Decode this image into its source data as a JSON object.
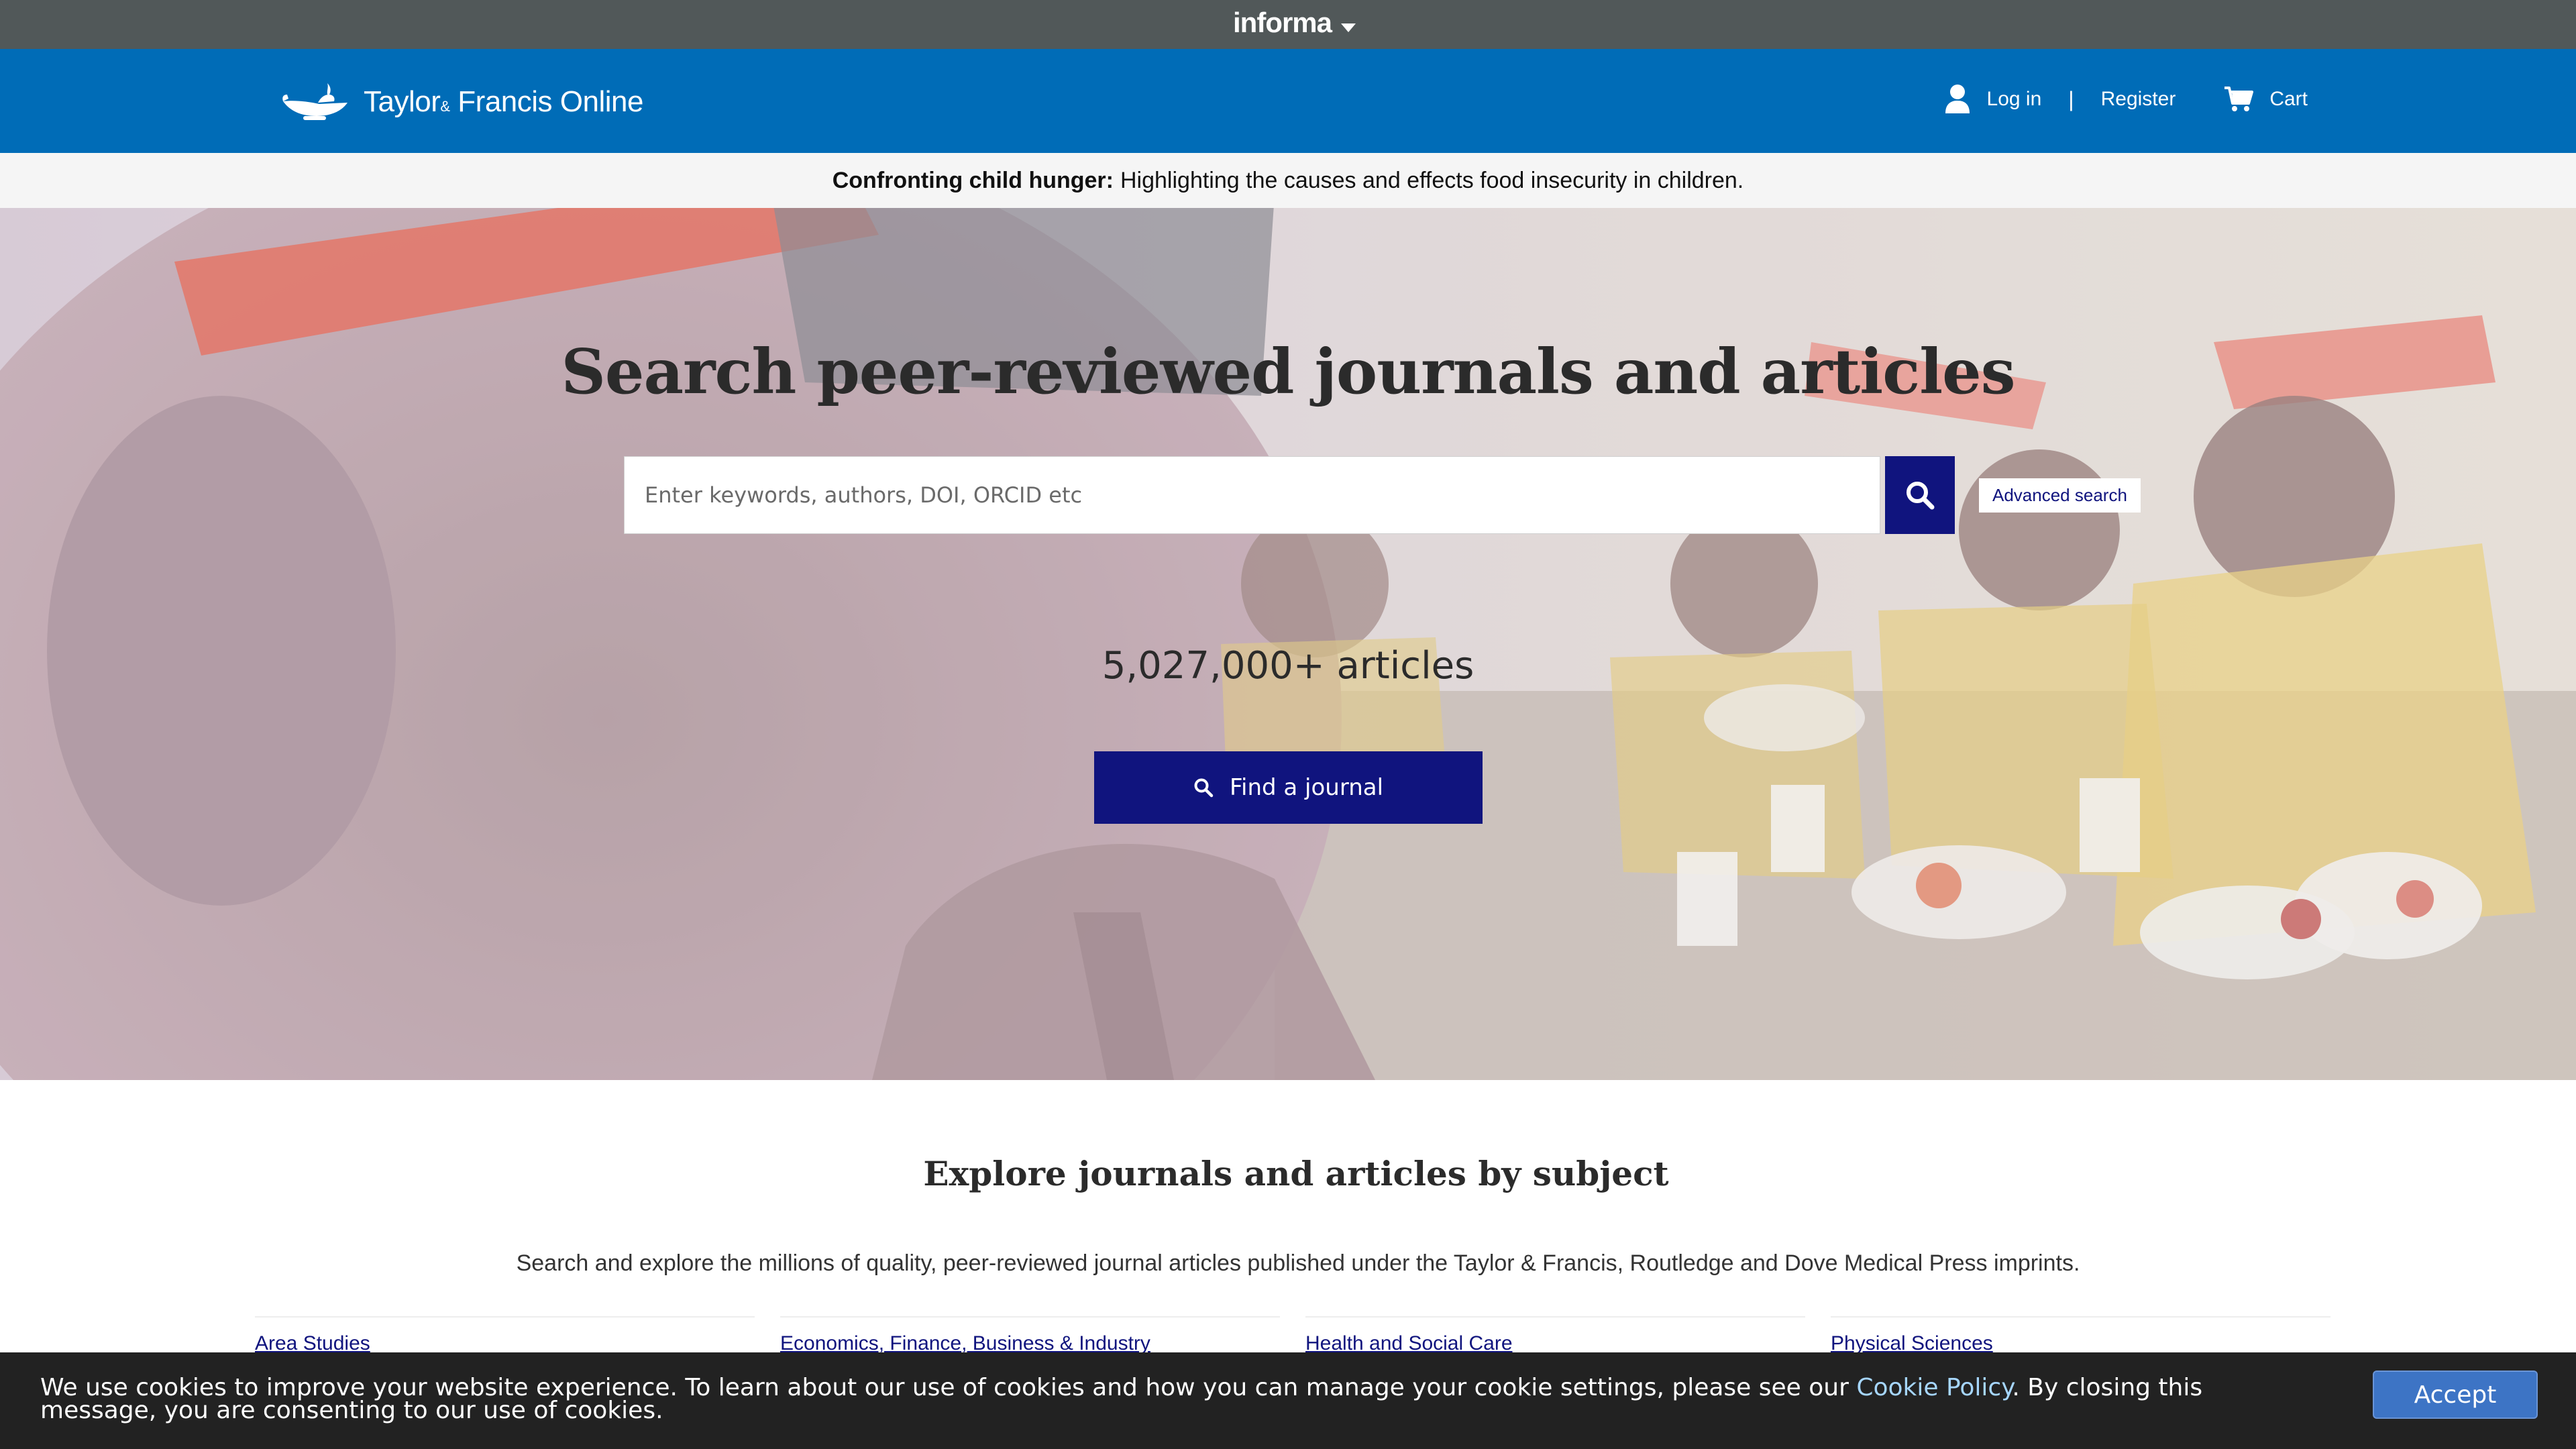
{
  "informa": {
    "label": "informa"
  },
  "header": {
    "brand": {
      "main": "Taylor",
      "amp": "&",
      "rest": " Francis Online"
    },
    "login_label": "Log in",
    "separator": "|",
    "register_label": "Register",
    "cart_label": "Cart"
  },
  "announcement": {
    "bold": "Confronting child hunger:",
    "text": "Highlighting the causes and effects food insecurity in children."
  },
  "hero": {
    "title": "Search peer-reviewed journals and articles",
    "search_placeholder": "Enter keywords, authors, DOI, ORCID etc",
    "search_value": "",
    "advanced_search_label": "Advanced search",
    "article_count": "5,027,000+ articles",
    "find_journal_label": "Find a journal"
  },
  "explore": {
    "title": "Explore journals and articles by subject",
    "subtitle": "Search and explore the millions of quality, peer-reviewed journal articles published under the Taylor & Francis, Routledge and Dove Medical Press imprints.",
    "subjects": [
      "Area Studies",
      "Economics, Finance, Business & Industry",
      "Health and Social Care",
      "Physical Sciences"
    ]
  },
  "cookie": {
    "text_before": "We use cookies to improve your website experience. To learn about our use of cookies and how you can manage your cookie settings, please see our ",
    "link_label": "Cookie Policy",
    "text_after": ". By closing this message, you are consenting to our use of cookies.",
    "accept_label": "Accept"
  },
  "icons": {
    "informa_caret": "caret-down-icon",
    "brand_logo": "lamp-logo-icon",
    "login": "user-icon",
    "cart": "cart-icon",
    "search": "search-icon"
  },
  "colors": {
    "informa_bar": "#515859",
    "header": "#006cb7",
    "button_navy": "#10147e",
    "cookie_bg": "#222222",
    "accept": "#3d74c5"
  }
}
